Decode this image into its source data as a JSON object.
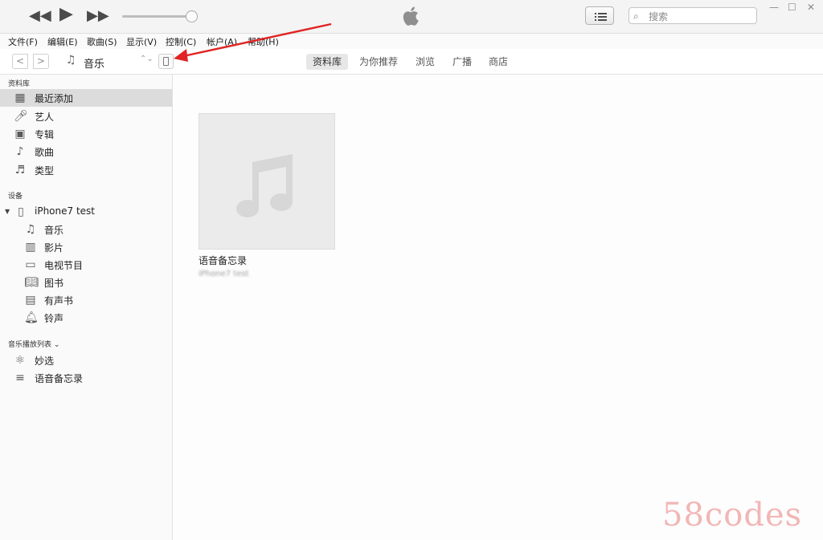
{
  "player": {
    "prev_icon": "rewind-icon",
    "play_icon": "play-icon",
    "next_icon": "fast-forward-icon",
    "volume": 0.95
  },
  "search": {
    "placeholder": "搜索"
  },
  "menu": [
    "文件(F)",
    "编辑(E)",
    "歌曲(S)",
    "显示(V)",
    "控制(C)",
    "帐户(A)",
    "帮助(H)"
  ],
  "nav": {
    "media_type": "音乐"
  },
  "tabs": [
    {
      "label": "资料库",
      "active": true
    },
    {
      "label": "为你推荐",
      "active": false
    },
    {
      "label": "浏览",
      "active": false
    },
    {
      "label": "广播",
      "active": false
    },
    {
      "label": "商店",
      "active": false
    }
  ],
  "sidebar": {
    "library_header": "资料库",
    "library_items": [
      {
        "label": "最近添加",
        "icon": "grid-icon",
        "selected": true
      },
      {
        "label": "艺人",
        "icon": "microphone-icon",
        "selected": false
      },
      {
        "label": "专辑",
        "icon": "album-icon",
        "selected": false
      },
      {
        "label": "歌曲",
        "icon": "music-note-icon",
        "selected": false
      },
      {
        "label": "类型",
        "icon": "genre-icon",
        "selected": false
      }
    ],
    "devices_header": "设备",
    "device_name": "iPhone7 test",
    "device_items": [
      {
        "label": "音乐",
        "icon": "music-note-icon"
      },
      {
        "label": "影片",
        "icon": "film-icon"
      },
      {
        "label": "电视节目",
        "icon": "tv-icon"
      },
      {
        "label": "图书",
        "icon": "book-icon"
      },
      {
        "label": "有声书",
        "icon": "audiobook-icon"
      },
      {
        "label": "铃声",
        "icon": "bell-icon"
      }
    ],
    "playlists_header": "音乐播放列表 ⌄",
    "playlist_items": [
      {
        "label": "妙选",
        "icon": "genius-icon"
      },
      {
        "label": "语音备忘录",
        "icon": "playlist-icon"
      }
    ]
  },
  "main": {
    "album_title": "语音备忘录",
    "album_subtitle": "iPhone7 test"
  },
  "watermark": "58codes",
  "colors": {
    "annotation_arrow": "#e02424",
    "selected_row": "#dcdcdc",
    "watermark": "#f2b6b6"
  }
}
